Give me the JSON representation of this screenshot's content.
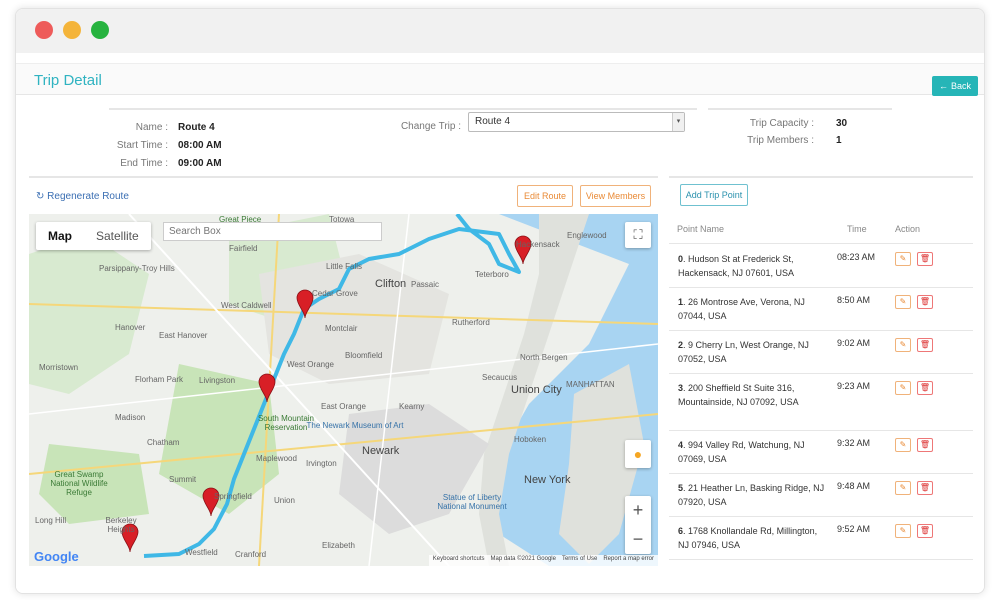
{
  "header": {
    "title": "Trip Detail",
    "back_label": "Back"
  },
  "trip_info": {
    "name_label": "Name :",
    "name_value": "Route 4",
    "start_label": "Start Time :",
    "start_value": "08:00 AM",
    "end_label": "End Time :",
    "end_value": "09:00 AM",
    "change_label": "Change Trip :",
    "change_value": "Route 4",
    "capacity_label": "Trip Capacity :",
    "capacity_value": "30",
    "members_label": "Trip Members :",
    "members_value": "1"
  },
  "toolbar": {
    "regenerate_label": "Regenerate Route",
    "edit_route_label": "Edit Route",
    "view_members_label": "View Members",
    "add_point_label": "Add Trip Point"
  },
  "map": {
    "toggle_map": "Map",
    "toggle_satellite": "Satellite",
    "search_placeholder": "Search Box",
    "google_logo": "Google",
    "attribution": [
      "Keyboard shortcuts",
      "Map data ©2021 Google",
      "Terms of Use",
      "Report a map error"
    ],
    "labels": [
      "Great Piece",
      "Totowa",
      "Hackensack",
      "Englewood",
      "Parsippany-Troy Hills",
      "Fairfield",
      "Little Falls",
      "Clifton",
      "Passaic",
      "Teterboro",
      "West Caldwell",
      "Cedar Grove",
      "Montclair",
      "Rutherford",
      "Hanover",
      "East Hanover",
      "West Orange",
      "Bloomfield",
      "North Bergen",
      "Morristown",
      "Florham Park",
      "Livingston",
      "Secaucus",
      "Union City",
      "MANHATTAN",
      "South Mountain Reservation",
      "East Orange",
      "Kearny",
      "Madison",
      "The Newark Museum of Art",
      "Chatham",
      "Newark",
      "Hoboken",
      "Maplewood",
      "Irvington",
      "Great Swamp National Wildlife Refuge",
      "Summit",
      "Springfield",
      "Union",
      "Statue of Liberty National Monument",
      "New York",
      "Long Hill",
      "Berkeley Heights",
      "Westfield",
      "Cranford",
      "Elizabeth"
    ]
  },
  "points_table": {
    "headers": {
      "point": "Point Name",
      "time": "Time",
      "action": "Action"
    },
    "rows": [
      {
        "index": "0",
        "address": ". Hudson St at Frederick St, Hackensack, NJ 07601, USA",
        "time": "08:23 AM"
      },
      {
        "index": "1",
        "address": ". 26 Montrose Ave, Verona, NJ 07044, USA",
        "time": "8:50 AM"
      },
      {
        "index": "2",
        "address": ". 9 Cherry Ln, West Orange, NJ 07052, USA",
        "time": "9:02 AM"
      },
      {
        "index": "3",
        "address": ". 200 Sheffield St Suite 316, Mountainside, NJ 07092, USA",
        "time": "9:23 AM"
      },
      {
        "index": "4",
        "address": ". 994 Valley Rd, Watchung, NJ 07069, USA",
        "time": "9:32 AM"
      },
      {
        "index": "5",
        "address": ". 21 Heather Ln, Basking Ridge, NJ 07920, USA",
        "time": "9:48 AM"
      },
      {
        "index": "6",
        "address": ". 1768 Knollandale Rd, Millington, NJ 07946, USA",
        "time": "9:52 AM"
      }
    ]
  },
  "colors": {
    "accent": "#26b5b7",
    "route": "#3fb8e6",
    "marker": "#d81f26",
    "water": "#a8d4f2",
    "park": "#c8e4b8"
  },
  "icons": {
    "regenerate": "refresh-icon",
    "back": "arrow-left-icon",
    "edit": "edit-icon",
    "delete": "trash-icon",
    "fullscreen": "fullscreen-icon",
    "pegman": "pegman-icon"
  }
}
